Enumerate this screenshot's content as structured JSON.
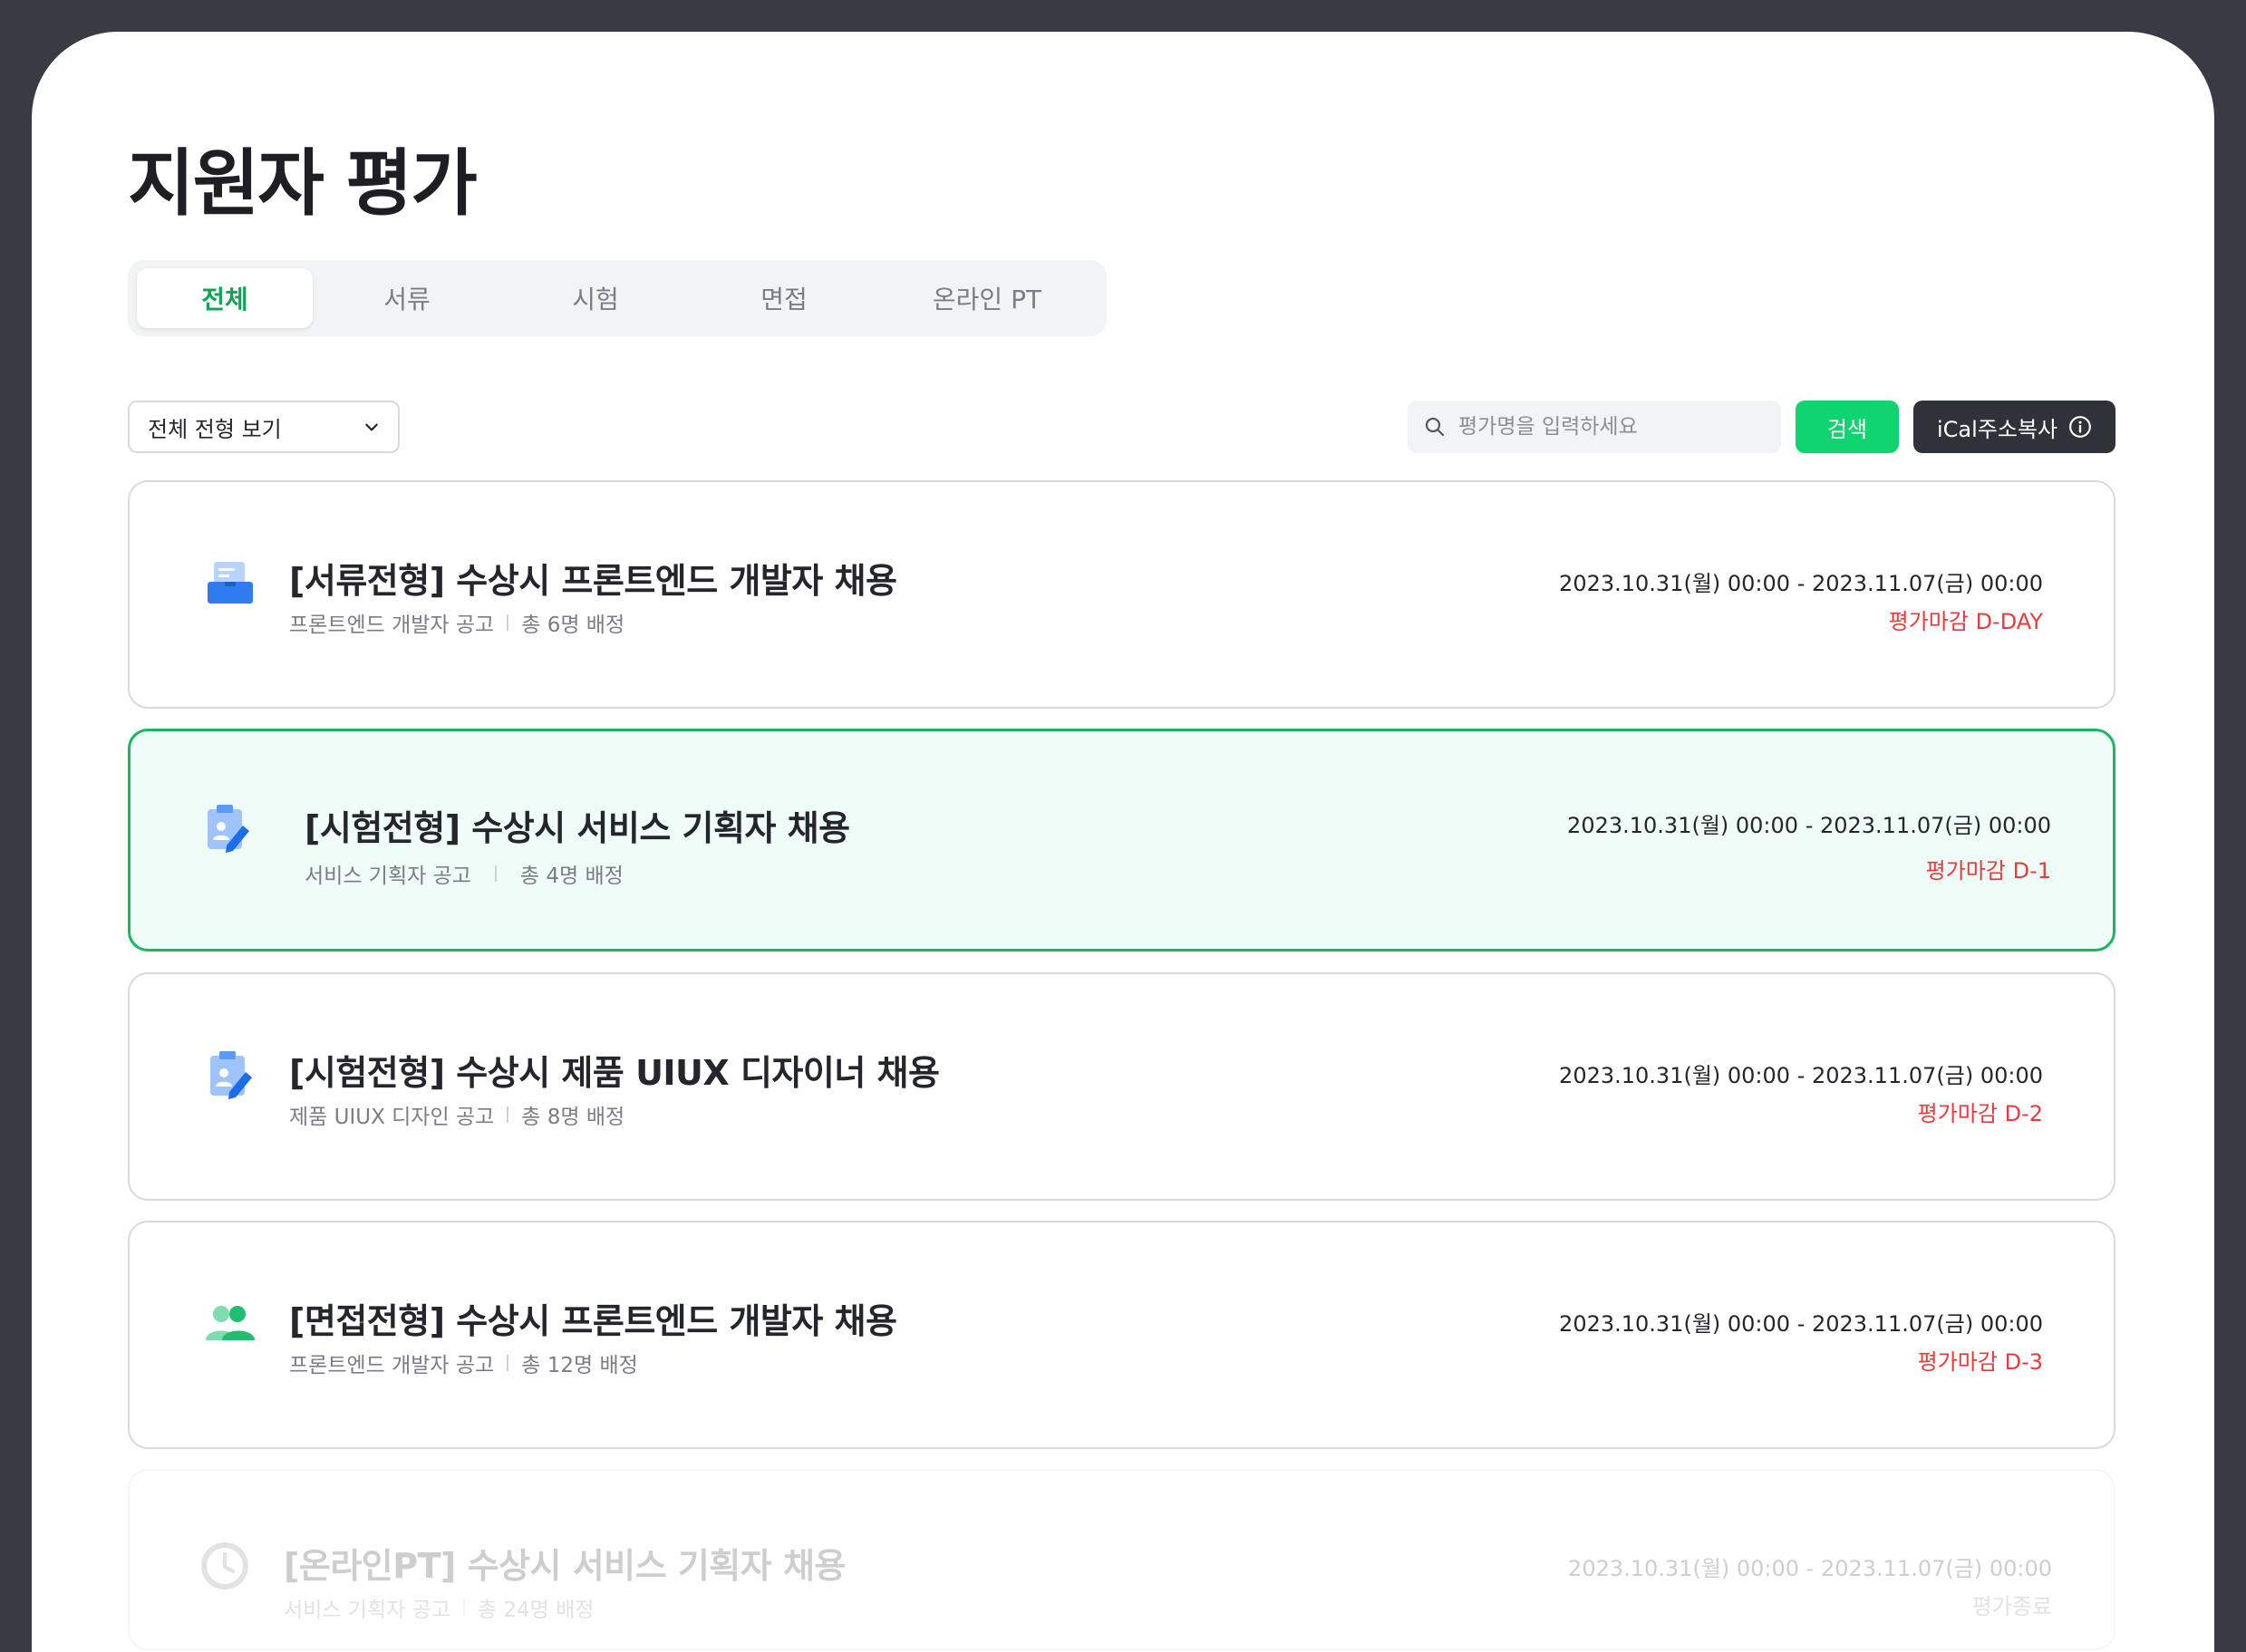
{
  "page": {
    "title": "지원자 평가"
  },
  "tabs": [
    {
      "label": "전체",
      "active": true
    },
    {
      "label": "서류",
      "active": false
    },
    {
      "label": "시험",
      "active": false
    },
    {
      "label": "면접",
      "active": false
    },
    {
      "label": "온라인 PT",
      "active": false
    }
  ],
  "toolbar": {
    "filter_value": "전체 전형 보기",
    "search_placeholder": "평가명을 입력하세요",
    "search_label": "검색",
    "ical_label": "iCal주소복사"
  },
  "colors": {
    "accent": "#11a356",
    "search_button": "#0fd46f",
    "deadline": "#e83b3b",
    "dark_button": "#2f3238"
  },
  "evaluations": [
    {
      "icon": "document-folder-icon",
      "title": "[서류전형] 수상시 프론트엔드 개발자 채용",
      "job": "프론트엔드 개발자 공고",
      "assigned": "총 6명 배정",
      "period": "2023.10.31(월) 00:00 - 2023.11.07(금) 00:00",
      "status": "평가마감 D-DAY"
    },
    {
      "icon": "clipboard-pencil-icon",
      "title": "[시험전형] 수상시 서비스 기획자 채용",
      "job": "서비스 기획자 공고",
      "assigned": "총 4명 배정",
      "period": "2023.10.31(월) 00:00 - 2023.11.07(금) 00:00",
      "status": "평가마감 D-1",
      "selected": true
    },
    {
      "icon": "clipboard-pencil-icon",
      "title": "[시험전형] 수상시 제품 UIUX 디자이너 채용",
      "job": "제품 UIUX 디자인 공고",
      "assigned": "총 8명 배정",
      "period": "2023.10.31(월) 00:00 - 2023.11.07(금) 00:00",
      "status": "평가마감 D-2"
    },
    {
      "icon": "people-icon",
      "title": "[면접전형] 수상시 프론트엔드 개발자 채용",
      "job": "프론트엔드 개발자 공고",
      "assigned": "총 12명 배정",
      "period": "2023.10.31(월) 00:00 - 2023.11.07(금) 00:00",
      "status": "평가마감 D-3"
    },
    {
      "icon": "clock-icon",
      "title": "[온라인PT] 수상시 서비스 기획자 채용",
      "job": "서비스 기획자 공고",
      "assigned": "총 24명 배정",
      "period": "2023.10.31(월) 00:00 - 2023.11.07(금) 00:00",
      "status": "평가종료",
      "ended": true
    }
  ]
}
